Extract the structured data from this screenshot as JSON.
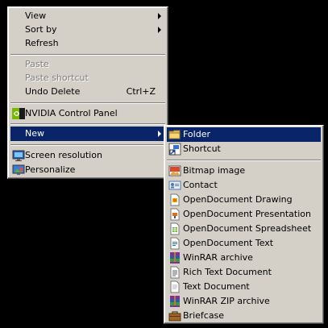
{
  "context_menu": {
    "view_label": "View",
    "sort_by_label": "Sort by",
    "refresh_label": "Refresh",
    "paste_label": "Paste",
    "paste_shortcut_label": "Paste shortcut",
    "undo_delete_label": "Undo Delete",
    "undo_delete_shortcut": "Ctrl+Z",
    "nvidia_label": "NVIDIA Control Panel",
    "new_label": "New",
    "screen_resolution_label": "Screen resolution",
    "personalize_label": "Personalize"
  },
  "new_submenu": {
    "items": [
      {
        "label": "Folder",
        "icon": "folder-icon"
      },
      {
        "label": "Shortcut",
        "icon": "shortcut-icon"
      },
      {
        "label": "Bitmap image",
        "icon": "bitmap-icon"
      },
      {
        "label": "Contact",
        "icon": "contact-icon"
      },
      {
        "label": "OpenDocument Drawing",
        "icon": "odg-icon"
      },
      {
        "label": "OpenDocument Presentation",
        "icon": "odp-icon"
      },
      {
        "label": "OpenDocument Spreadsheet",
        "icon": "ods-icon"
      },
      {
        "label": "OpenDocument Text",
        "icon": "odt-icon"
      },
      {
        "label": "WinRAR archive",
        "icon": "winrar-icon"
      },
      {
        "label": "Rich Text Document",
        "icon": "rtf-icon"
      },
      {
        "label": "Text Document",
        "icon": "txt-icon"
      },
      {
        "label": "WinRAR ZIP archive",
        "icon": "winrar-zip-icon"
      },
      {
        "label": "Briefcase",
        "icon": "briefcase-icon"
      }
    ]
  },
  "colors": {
    "menu_bg": "#d4d0c8",
    "selection": "#0a246a",
    "disabled_text": "#808080"
  }
}
